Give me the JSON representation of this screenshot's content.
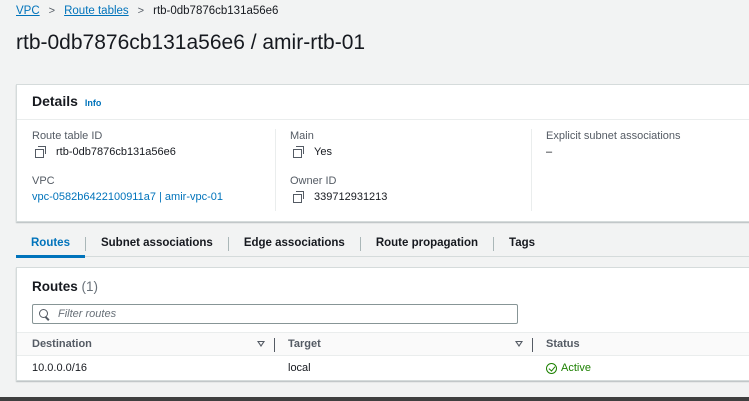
{
  "breadcrumb": {
    "items": [
      "VPC",
      "Route tables"
    ],
    "current": "rtb-0db7876cb131a56e6"
  },
  "page_title": "rtb-0db7876cb131a56e6 / amir-rtb-01",
  "details": {
    "title": "Details",
    "info": "Info",
    "route_table_id": {
      "label": "Route table ID",
      "value": "rtb-0db7876cb131a56e6"
    },
    "vpc": {
      "label": "VPC",
      "value": "vpc-0582b6422100911a7 | amir-vpc-01"
    },
    "main": {
      "label": "Main",
      "value": "Yes"
    },
    "owner_id": {
      "label": "Owner ID",
      "value": "339712931213"
    },
    "explicit_subnet": {
      "label": "Explicit subnet associations",
      "value": "–"
    }
  },
  "tabs": [
    "Routes",
    "Subnet associations",
    "Edge associations",
    "Route propagation",
    "Tags"
  ],
  "active_tab": "Routes",
  "routes": {
    "title": "Routes",
    "count": "(1)",
    "filter_placeholder": "Filter routes",
    "columns": {
      "destination": "Destination",
      "target": "Target",
      "status": "Status"
    },
    "rows": [
      {
        "destination": "10.0.0.0/16",
        "target": "local",
        "status": "Active"
      }
    ]
  },
  "colors": {
    "link": "#0073bb",
    "success": "#1d8102",
    "text": "#16191f",
    "background": "#f2f3f3"
  },
  "icons": [
    "copy-icon",
    "search-icon",
    "sort-icon",
    "status-success-icon"
  ]
}
